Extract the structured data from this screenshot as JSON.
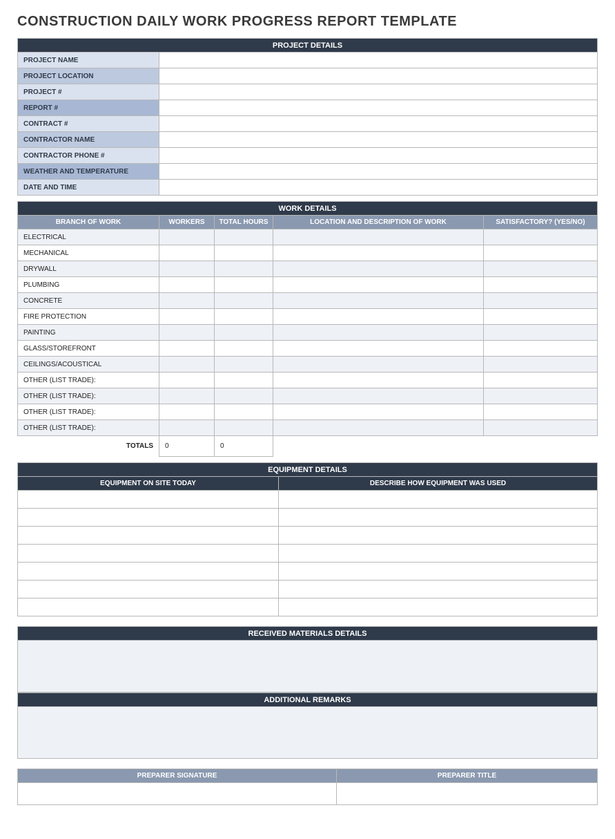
{
  "title": "CONSTRUCTION DAILY WORK PROGRESS REPORT TEMPLATE",
  "projectDetails": {
    "header": "PROJECT DETAILS",
    "rows": [
      {
        "label": "PROJECT NAME",
        "shade": "light",
        "value": ""
      },
      {
        "label": "PROJECT LOCATION",
        "shade": "mid",
        "value": ""
      },
      {
        "label": "PROJECT #",
        "shade": "light",
        "value": ""
      },
      {
        "label": "REPORT #",
        "shade": "dark",
        "value": ""
      },
      {
        "label": "CONTRACT #",
        "shade": "light",
        "value": ""
      },
      {
        "label": "CONTRACTOR NAME",
        "shade": "mid",
        "value": ""
      },
      {
        "label": "CONTRACTOR PHONE #",
        "shade": "light",
        "value": ""
      },
      {
        "label": "WEATHER AND TEMPERATURE",
        "shade": "dark",
        "value": ""
      },
      {
        "label": "DATE AND TIME",
        "shade": "light",
        "value": ""
      }
    ]
  },
  "workDetails": {
    "header": "WORK DETAILS",
    "cols": {
      "branch": "BRANCH OF WORK",
      "workers": "WORKERS",
      "hours": "TOTAL HOURS",
      "location": "LOCATION AND DESCRIPTION OF WORK",
      "satisfactory": "SATISFACTORY? (YES/NO)"
    },
    "rows": [
      {
        "branch": "ELECTRICAL",
        "workers": "",
        "hours": "",
        "location": "",
        "satisfactory": ""
      },
      {
        "branch": "MECHANICAL",
        "workers": "",
        "hours": "",
        "location": "",
        "satisfactory": ""
      },
      {
        "branch": "DRYWALL",
        "workers": "",
        "hours": "",
        "location": "",
        "satisfactory": ""
      },
      {
        "branch": "PLUMBING",
        "workers": "",
        "hours": "",
        "location": "",
        "satisfactory": ""
      },
      {
        "branch": "CONCRETE",
        "workers": "",
        "hours": "",
        "location": "",
        "satisfactory": ""
      },
      {
        "branch": "FIRE PROTECTION",
        "workers": "",
        "hours": "",
        "location": "",
        "satisfactory": ""
      },
      {
        "branch": "PAINTING",
        "workers": "",
        "hours": "",
        "location": "",
        "satisfactory": ""
      },
      {
        "branch": "GLASS/STOREFRONT",
        "workers": "",
        "hours": "",
        "location": "",
        "satisfactory": ""
      },
      {
        "branch": "CEILINGS/ACOUSTICAL",
        "workers": "",
        "hours": "",
        "location": "",
        "satisfactory": ""
      },
      {
        "branch": "OTHER (LIST TRADE):",
        "workers": "",
        "hours": "",
        "location": "",
        "satisfactory": ""
      },
      {
        "branch": "OTHER (LIST TRADE):",
        "workers": "",
        "hours": "",
        "location": "",
        "satisfactory": ""
      },
      {
        "branch": "OTHER (LIST TRADE):",
        "workers": "",
        "hours": "",
        "location": "",
        "satisfactory": ""
      },
      {
        "branch": "OTHER (LIST TRADE):",
        "workers": "",
        "hours": "",
        "location": "",
        "satisfactory": ""
      }
    ],
    "totalsLabel": "TOTALS",
    "totals": {
      "workers": "0",
      "hours": "0"
    }
  },
  "equipmentDetails": {
    "header": "EQUIPMENT DETAILS",
    "cols": {
      "onsite": "EQUIPMENT ON SITE TODAY",
      "used": "DESCRIBE HOW EQUIPMENT WAS USED"
    },
    "rowCount": 7
  },
  "receivedMaterials": {
    "header": "RECEIVED MATERIALS DETAILS",
    "value": ""
  },
  "additionalRemarks": {
    "header": "ADDITIONAL REMARKS",
    "value": ""
  },
  "signature": {
    "cols": {
      "sig": "PREPARER SIGNATURE",
      "title": "PREPARER TITLE"
    },
    "sigValue": "",
    "titleValue": ""
  }
}
